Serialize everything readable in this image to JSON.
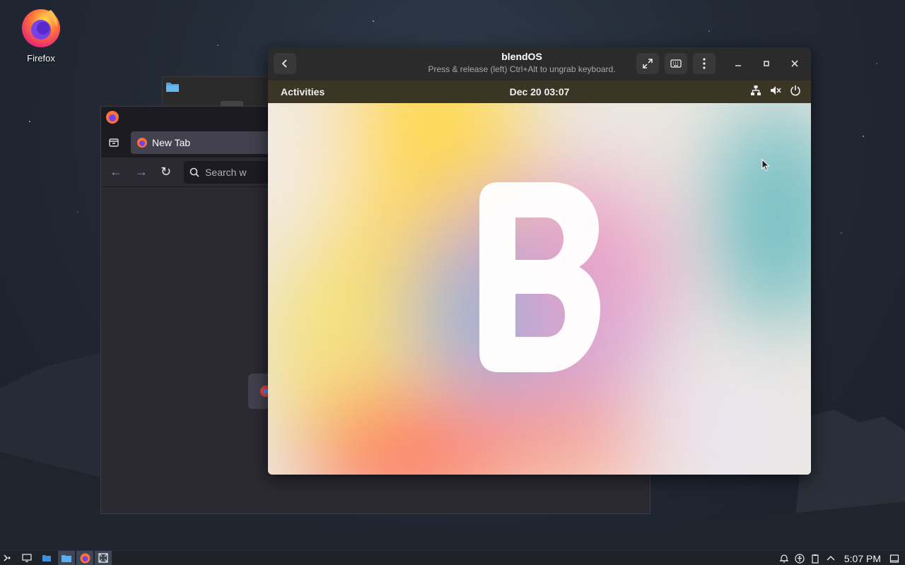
{
  "desktop": {
    "icon_label": "Firefox"
  },
  "firefox": {
    "tab_label": "New Tab",
    "search_placeholder": "Search w"
  },
  "vm": {
    "title": "blendOS",
    "subtitle": "Press & release (left) Ctrl+Alt to ungrab keyboard.",
    "gnome_activities": "Activities",
    "gnome_clock": "Dec 20  03:07",
    "wallpaper_letter": "B"
  },
  "taskbar": {
    "clock": "5:07 PM"
  },
  "colors": {
    "accent": "#3d4654",
    "firefox_orange": "#ff7139",
    "firefox_purple": "#7542e5"
  }
}
